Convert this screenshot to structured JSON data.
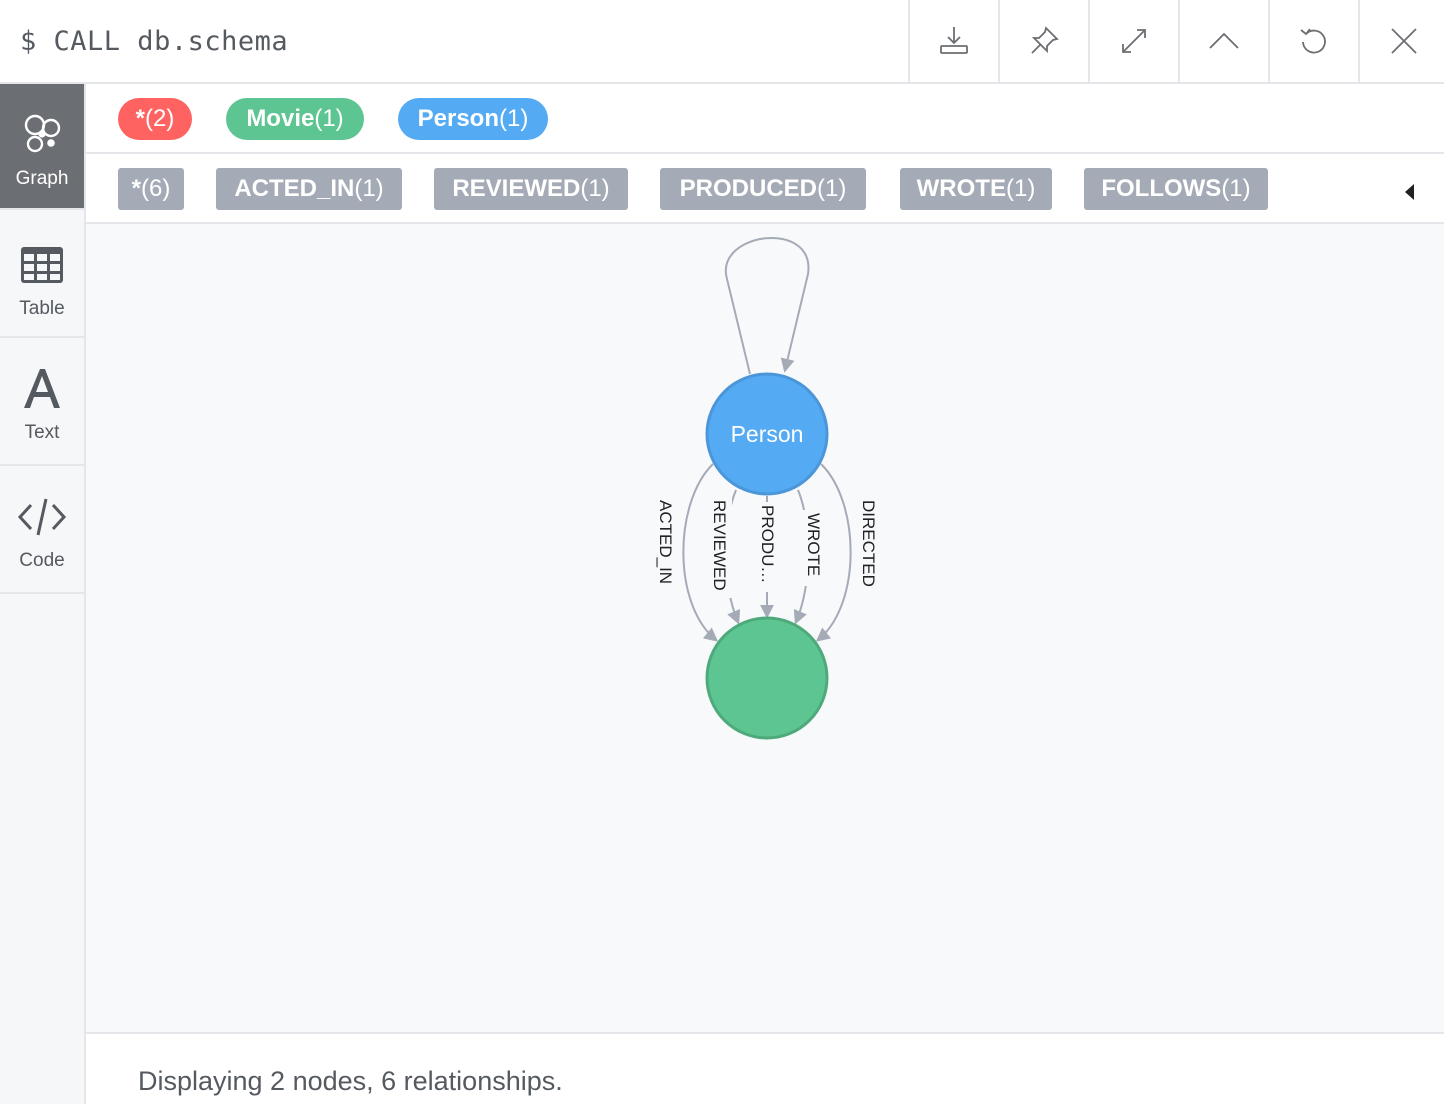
{
  "query": {
    "prompt": "$",
    "text": "CALL db.schema"
  },
  "toolbar": {
    "buttons": [
      {
        "name": "export-button",
        "icon": "download-icon"
      },
      {
        "name": "pin-button",
        "icon": "pin-icon"
      },
      {
        "name": "fullscreen-button",
        "icon": "expand-icon"
      },
      {
        "name": "collapse-button",
        "icon": "chevron-up-icon"
      },
      {
        "name": "rerun-button",
        "icon": "refresh-icon"
      },
      {
        "name": "close-button",
        "icon": "close-icon"
      }
    ]
  },
  "views": [
    {
      "label": "Graph",
      "icon": "graph-icon",
      "active": true
    },
    {
      "label": "Table",
      "icon": "table-icon",
      "active": false
    },
    {
      "label": "Text",
      "icon": "text-icon",
      "active": false
    },
    {
      "label": "Code",
      "icon": "code-icon",
      "active": false
    }
  ],
  "legend": {
    "node_labels": [
      {
        "name": "*",
        "count": "(2)",
        "color": "#ff6361"
      },
      {
        "name": "Movie",
        "count": "(1)",
        "color": "#5dc591"
      },
      {
        "name": "Person",
        "count": "(1)",
        "color": "#54aaf3"
      }
    ],
    "relationship_types": [
      {
        "name": "*",
        "count": "(6)"
      },
      {
        "name": "ACTED_IN",
        "count": "(1)"
      },
      {
        "name": "REVIEWED",
        "count": "(1)"
      },
      {
        "name": "PRODUCED",
        "count": "(1)"
      },
      {
        "name": "WROTE",
        "count": "(1)"
      },
      {
        "name": "FOLLOWS",
        "count": "(1)"
      }
    ]
  },
  "graph": {
    "nodes": [
      {
        "id": "person",
        "caption": "Person",
        "color": "#54aaf3",
        "border": "#4a96d8"
      },
      {
        "id": "movie",
        "caption": "",
        "color": "#5dc591",
        "border": "#4eaa7b"
      }
    ],
    "relationships": [
      {
        "type": "FOLLOWS",
        "label": "",
        "from": "person",
        "to": "person"
      },
      {
        "type": "ACTED_IN",
        "label": "ACTED_IN",
        "from": "person",
        "to": "movie"
      },
      {
        "type": "REVIEWED",
        "label": "REVIEWED",
        "from": "person",
        "to": "movie"
      },
      {
        "type": "PRODUCED",
        "label": "PRODU…",
        "from": "person",
        "to": "movie"
      },
      {
        "type": "WROTE",
        "label": "WROTE",
        "from": "person",
        "to": "movie"
      },
      {
        "type": "DIRECTED",
        "label": "DIRECTED",
        "from": "person",
        "to": "movie"
      }
    ]
  },
  "status": {
    "message": "Displaying 2 nodes, 6 relationships."
  }
}
